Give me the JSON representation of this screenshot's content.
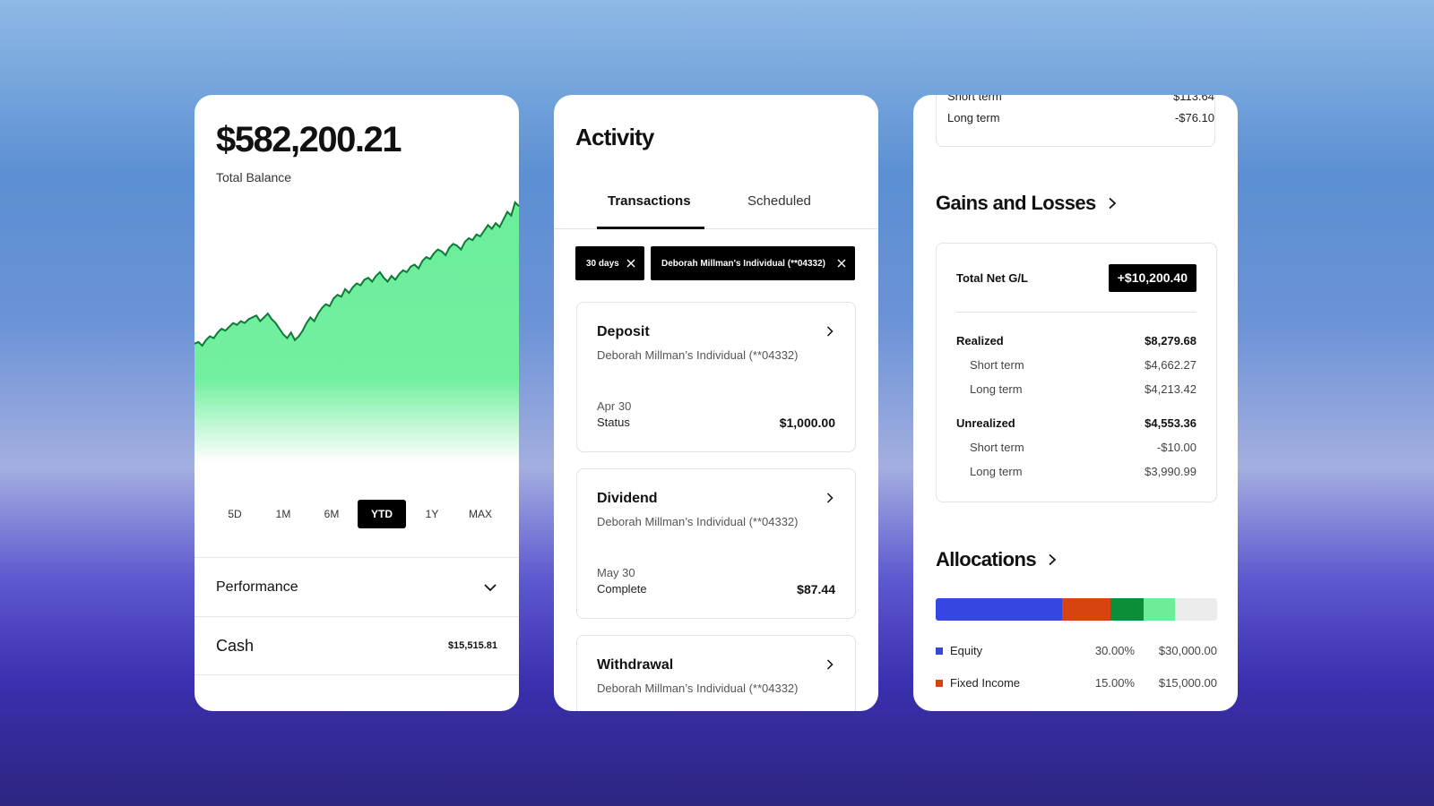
{
  "overview": {
    "balance": "$582,200.21",
    "balance_label": "Total Balance",
    "chart_color": "#6bee9c",
    "line_color": "#0d7a35",
    "ranges": [
      "5D",
      "1M",
      "6M",
      "YTD",
      "1Y",
      "MAX"
    ],
    "active_range": "YTD",
    "performance_label": "Performance",
    "cash_label": "Cash",
    "cash_value": "$15,515.81"
  },
  "chart_data": {
    "type": "area",
    "values": [
      22,
      23,
      21,
      24,
      26,
      25,
      28,
      30,
      29,
      31,
      33,
      32,
      34,
      33,
      35,
      36,
      37,
      34,
      36,
      38,
      35,
      33,
      30,
      27,
      25,
      28,
      24,
      26,
      29,
      33,
      36,
      34,
      38,
      41,
      43,
      42,
      46,
      48,
      47,
      51,
      49,
      52,
      54,
      53,
      56,
      57,
      55,
      58,
      60,
      57,
      55,
      58,
      56,
      59,
      61,
      60,
      63,
      64,
      62,
      66,
      68,
      67,
      70,
      72,
      71,
      69,
      73,
      75,
      74,
      72,
      76,
      78,
      77,
      80,
      79,
      82,
      85,
      83,
      86,
      84,
      88,
      92,
      90,
      97,
      95
    ]
  },
  "activity": {
    "title": "Activity",
    "tabs": [
      "Transactions",
      "Scheduled"
    ],
    "chips": [
      "30 days",
      "Deborah Millman's Individual (**04332)"
    ],
    "transactions": [
      {
        "type": "Deposit",
        "account": "Deborah Millman’s Individual (**04332)",
        "date": "Apr 30",
        "status": "Status",
        "amount": "$1,000.00"
      },
      {
        "type": "Dividend",
        "account": "Deborah Millman’s Individual (**04332)",
        "date": "May 30",
        "status": "Complete",
        "amount": "$87.44"
      },
      {
        "type": "Withdrawal",
        "account": "Deborah Millman’s Individual (**04332)"
      }
    ]
  },
  "gains": {
    "top_short_label": "Short term",
    "top_short_value": "$113.64",
    "top_long_label": "Long term",
    "top_long_value": "-$76.10",
    "title": "Gains and Losses",
    "net_label": "Total Net G/L",
    "net_value": "+$10,200.40",
    "rows": [
      {
        "label": "Realized",
        "value": "$8,279.68"
      },
      {
        "label": "Short term",
        "value": "$4,662.27"
      },
      {
        "label": "Long term",
        "value": "$4,213.42"
      },
      {
        "label": "Unrealized",
        "value": "$4,553.36"
      },
      {
        "label": "Short term",
        "value": "-$10.00"
      },
      {
        "label": "Long term",
        "value": "$3,990.99"
      }
    ]
  },
  "allocations": {
    "title": "Allocations",
    "segments": [
      {
        "color": "#3547e0",
        "pct": 45
      },
      {
        "color": "#d84410",
        "pct": 17
      },
      {
        "color": "#0b8e3a",
        "pct": 12
      },
      {
        "color": "#6fec9a",
        "pct": 11
      },
      {
        "color": "#ececec",
        "pct": 15
      }
    ],
    "legend": [
      {
        "name": "Equity",
        "pct": "30.00%",
        "value": "$30,000.00",
        "color": "#3547e0"
      },
      {
        "name": "Fixed Income",
        "pct": "15.00%",
        "value": "$15,000.00",
        "color": "#d84410"
      }
    ]
  }
}
